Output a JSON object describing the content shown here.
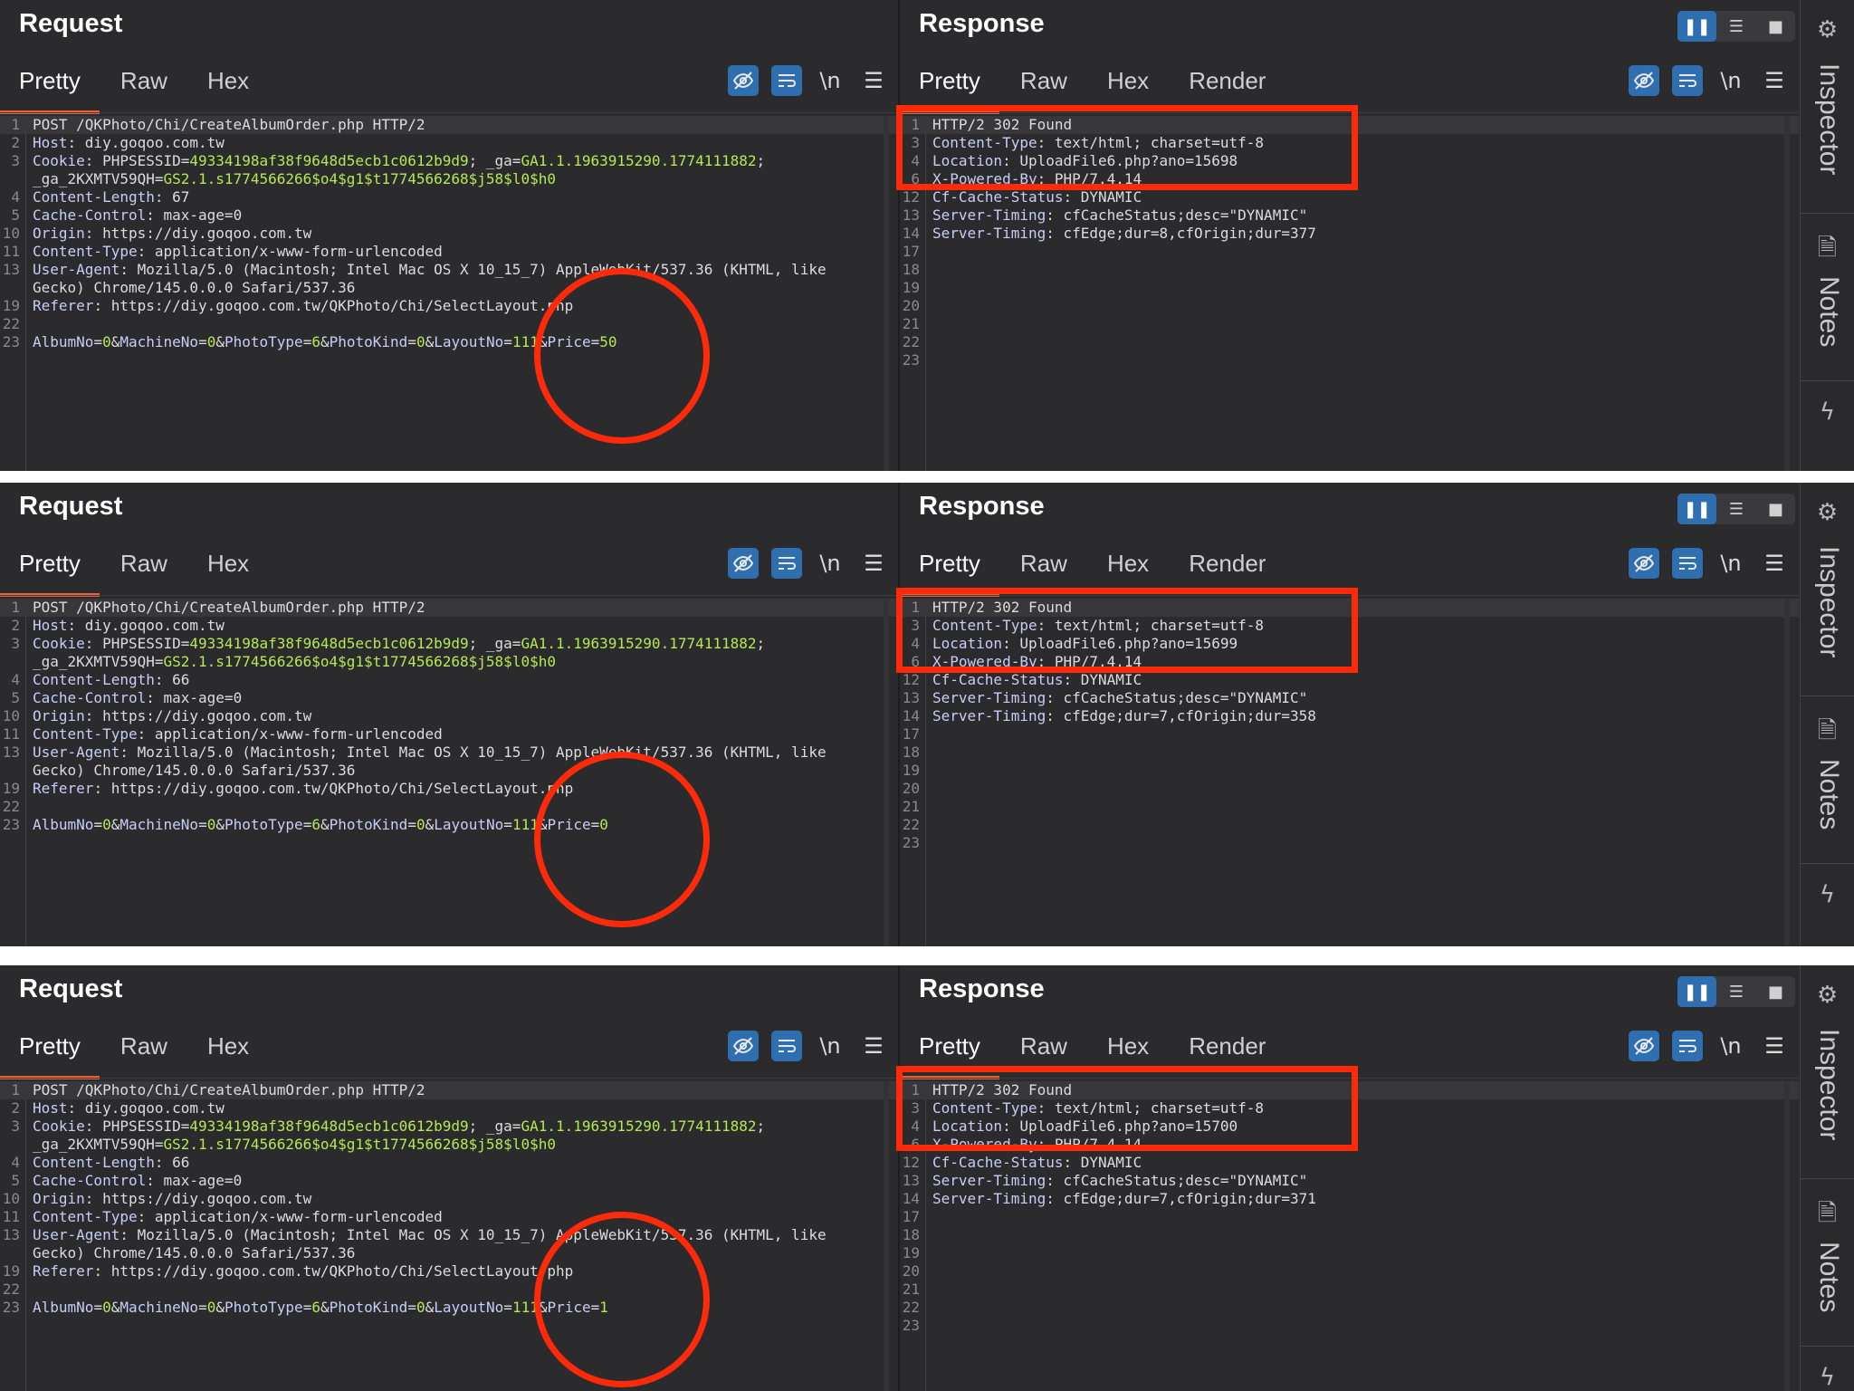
{
  "labels": {
    "request_title": "Request",
    "response_title": "Response",
    "req_tabs": [
      "Pretty",
      "Raw",
      "Hex"
    ],
    "res_tabs": [
      "Pretty",
      "Raw",
      "Hex",
      "Render"
    ],
    "newline_button": "\\n",
    "inspector": "Inspector",
    "notes": "Notes"
  },
  "colors": {
    "accent": "#e8623c",
    "annotation": "#ff2a0a",
    "button_blue": "#2f6fb0",
    "param_value": "#b5e853"
  },
  "icons": [
    "hide-icon",
    "wrap-lines-icon",
    "menu-icon",
    "split-layout-icon",
    "stacked-layout-icon",
    "single-layout-icon",
    "inspector-icon",
    "notes-icon",
    "bolt-icon"
  ],
  "screens": [
    {
      "request": [
        {
          "n": "1",
          "t": "POST /QKPhoto/Chi/CreateAlbumOrder.php HTTP/2"
        },
        {
          "n": "2",
          "t": "Host: diy.goqoo.com.tw"
        },
        {
          "n": "3",
          "t": "Cookie: PHPSESSID=49334198af38f9648d5ecb1c0612b9d9; _ga=GA1.1.1963915290.1774111882;"
        },
        {
          "n": "",
          "t": "_ga_2KXMTV59QH=GS2.1.s1774566266$o4$g1$t1774566268$j58$l0$h0"
        },
        {
          "n": "4",
          "t": "Content-Length: 67"
        },
        {
          "n": "5",
          "t": "Cache-Control: max-age=0"
        },
        {
          "n": "10",
          "t": "Origin: https://diy.goqoo.com.tw"
        },
        {
          "n": "11",
          "t": "Content-Type: application/x-www-form-urlencoded"
        },
        {
          "n": "13",
          "t": "User-Agent: Mozilla/5.0 (Macintosh; Intel Mac OS X 10_15_7) AppleWebKit/537.36 (KHTML, like"
        },
        {
          "n": "",
          "t": "Gecko) Chrome/145.0.0.0 Safari/537.36"
        },
        {
          "n": "19",
          "t": "Referer: https://diy.goqoo.com.tw/QKPhoto/Chi/SelectLayout.php"
        },
        {
          "n": "22",
          "t": ""
        },
        {
          "n": "23",
          "t": "AlbumNo=0&MachineNo=0&PhotoType=6&PhotoKind=0&LayoutNo=111&Price=50"
        }
      ],
      "response": [
        {
          "n": "1",
          "t": "HTTP/2 302 Found"
        },
        {
          "n": "3",
          "t": "Content-Type: text/html; charset=utf-8"
        },
        {
          "n": "4",
          "t": "Location: UploadFile6.php?ano=15698"
        },
        {
          "n": "6",
          "t": "X-Powered-By: PHP/7.4.14"
        },
        {
          "n": "12",
          "t": "Cf-Cache-Status: DYNAMIC"
        },
        {
          "n": "13",
          "t": "Server-Timing: cfCacheStatus;desc=\"DYNAMIC\""
        },
        {
          "n": "14",
          "t": "Server-Timing: cfEdge;dur=8,cfOrigin;dur=377"
        },
        {
          "n": "17",
          "t": ""
        },
        {
          "n": "18",
          "t": ""
        },
        {
          "n": "19",
          "t": ""
        },
        {
          "n": "20",
          "t": ""
        },
        {
          "n": "21",
          "t": ""
        },
        {
          "n": "22",
          "t": ""
        },
        {
          "n": "23",
          "t": ""
        }
      ]
    },
    {
      "request": [
        {
          "n": "1",
          "t": "POST /QKPhoto/Chi/CreateAlbumOrder.php HTTP/2"
        },
        {
          "n": "2",
          "t": "Host: diy.goqoo.com.tw"
        },
        {
          "n": "3",
          "t": "Cookie: PHPSESSID=49334198af38f9648d5ecb1c0612b9d9; _ga=GA1.1.1963915290.1774111882;"
        },
        {
          "n": "",
          "t": "_ga_2KXMTV59QH=GS2.1.s1774566266$o4$g1$t1774566268$j58$l0$h0"
        },
        {
          "n": "4",
          "t": "Content-Length: 66"
        },
        {
          "n": "5",
          "t": "Cache-Control: max-age=0"
        },
        {
          "n": "10",
          "t": "Origin: https://diy.goqoo.com.tw"
        },
        {
          "n": "11",
          "t": "Content-Type: application/x-www-form-urlencoded"
        },
        {
          "n": "13",
          "t": "User-Agent: Mozilla/5.0 (Macintosh; Intel Mac OS X 10_15_7) AppleWebKit/537.36 (KHTML, like"
        },
        {
          "n": "",
          "t": "Gecko) Chrome/145.0.0.0 Safari/537.36"
        },
        {
          "n": "19",
          "t": "Referer: https://diy.goqoo.com.tw/QKPhoto/Chi/SelectLayout.php"
        },
        {
          "n": "22",
          "t": ""
        },
        {
          "n": "23",
          "t": "AlbumNo=0&MachineNo=0&PhotoType=6&PhotoKind=0&LayoutNo=111&Price=0"
        }
      ],
      "response": [
        {
          "n": "1",
          "t": "HTTP/2 302 Found"
        },
        {
          "n": "3",
          "t": "Content-Type: text/html; charset=utf-8"
        },
        {
          "n": "4",
          "t": "Location: UploadFile6.php?ano=15699"
        },
        {
          "n": "6",
          "t": "X-Powered-By: PHP/7.4.14"
        },
        {
          "n": "12",
          "t": "Cf-Cache-Status: DYNAMIC"
        },
        {
          "n": "13",
          "t": "Server-Timing: cfCacheStatus;desc=\"DYNAMIC\""
        },
        {
          "n": "14",
          "t": "Server-Timing: cfEdge;dur=7,cfOrigin;dur=358"
        },
        {
          "n": "17",
          "t": ""
        },
        {
          "n": "18",
          "t": ""
        },
        {
          "n": "19",
          "t": ""
        },
        {
          "n": "20",
          "t": ""
        },
        {
          "n": "21",
          "t": ""
        },
        {
          "n": "22",
          "t": ""
        },
        {
          "n": "23",
          "t": ""
        }
      ]
    },
    {
      "request": [
        {
          "n": "1",
          "t": "POST /QKPhoto/Chi/CreateAlbumOrder.php HTTP/2"
        },
        {
          "n": "2",
          "t": "Host: diy.goqoo.com.tw"
        },
        {
          "n": "3",
          "t": "Cookie: PHPSESSID=49334198af38f9648d5ecb1c0612b9d9; _ga=GA1.1.1963915290.1774111882;"
        },
        {
          "n": "",
          "t": "_ga_2KXMTV59QH=GS2.1.s1774566266$o4$g1$t1774566268$j58$l0$h0"
        },
        {
          "n": "4",
          "t": "Content-Length: 66"
        },
        {
          "n": "5",
          "t": "Cache-Control: max-age=0"
        },
        {
          "n": "10",
          "t": "Origin: https://diy.goqoo.com.tw"
        },
        {
          "n": "11",
          "t": "Content-Type: application/x-www-form-urlencoded"
        },
        {
          "n": "13",
          "t": "User-Agent: Mozilla/5.0 (Macintosh; Intel Mac OS X 10_15_7) AppleWebKit/537.36 (KHTML, like"
        },
        {
          "n": "",
          "t": "Gecko) Chrome/145.0.0.0 Safari/537.36"
        },
        {
          "n": "19",
          "t": "Referer: https://diy.goqoo.com.tw/QKPhoto/Chi/SelectLayout.php"
        },
        {
          "n": "22",
          "t": ""
        },
        {
          "n": "23",
          "t": "AlbumNo=0&MachineNo=0&PhotoType=6&PhotoKind=0&LayoutNo=111&Price=1"
        }
      ],
      "response": [
        {
          "n": "1",
          "t": "HTTP/2 302 Found"
        },
        {
          "n": "3",
          "t": "Content-Type: text/html; charset=utf-8"
        },
        {
          "n": "4",
          "t": "Location: UploadFile6.php?ano=15700"
        },
        {
          "n": "6",
          "t": "X-Powered-By: PHP/7.4.14"
        },
        {
          "n": "12",
          "t": "Cf-Cache-Status: DYNAMIC"
        },
        {
          "n": "13",
          "t": "Server-Timing: cfCacheStatus;desc=\"DYNAMIC\""
        },
        {
          "n": "14",
          "t": "Server-Timing: cfEdge;dur=7,cfOrigin;dur=371"
        },
        {
          "n": "17",
          "t": ""
        },
        {
          "n": "18",
          "t": ""
        },
        {
          "n": "19",
          "t": ""
        },
        {
          "n": "20",
          "t": ""
        },
        {
          "n": "21",
          "t": ""
        },
        {
          "n": "22",
          "t": ""
        },
        {
          "n": "23",
          "t": ""
        }
      ]
    }
  ]
}
